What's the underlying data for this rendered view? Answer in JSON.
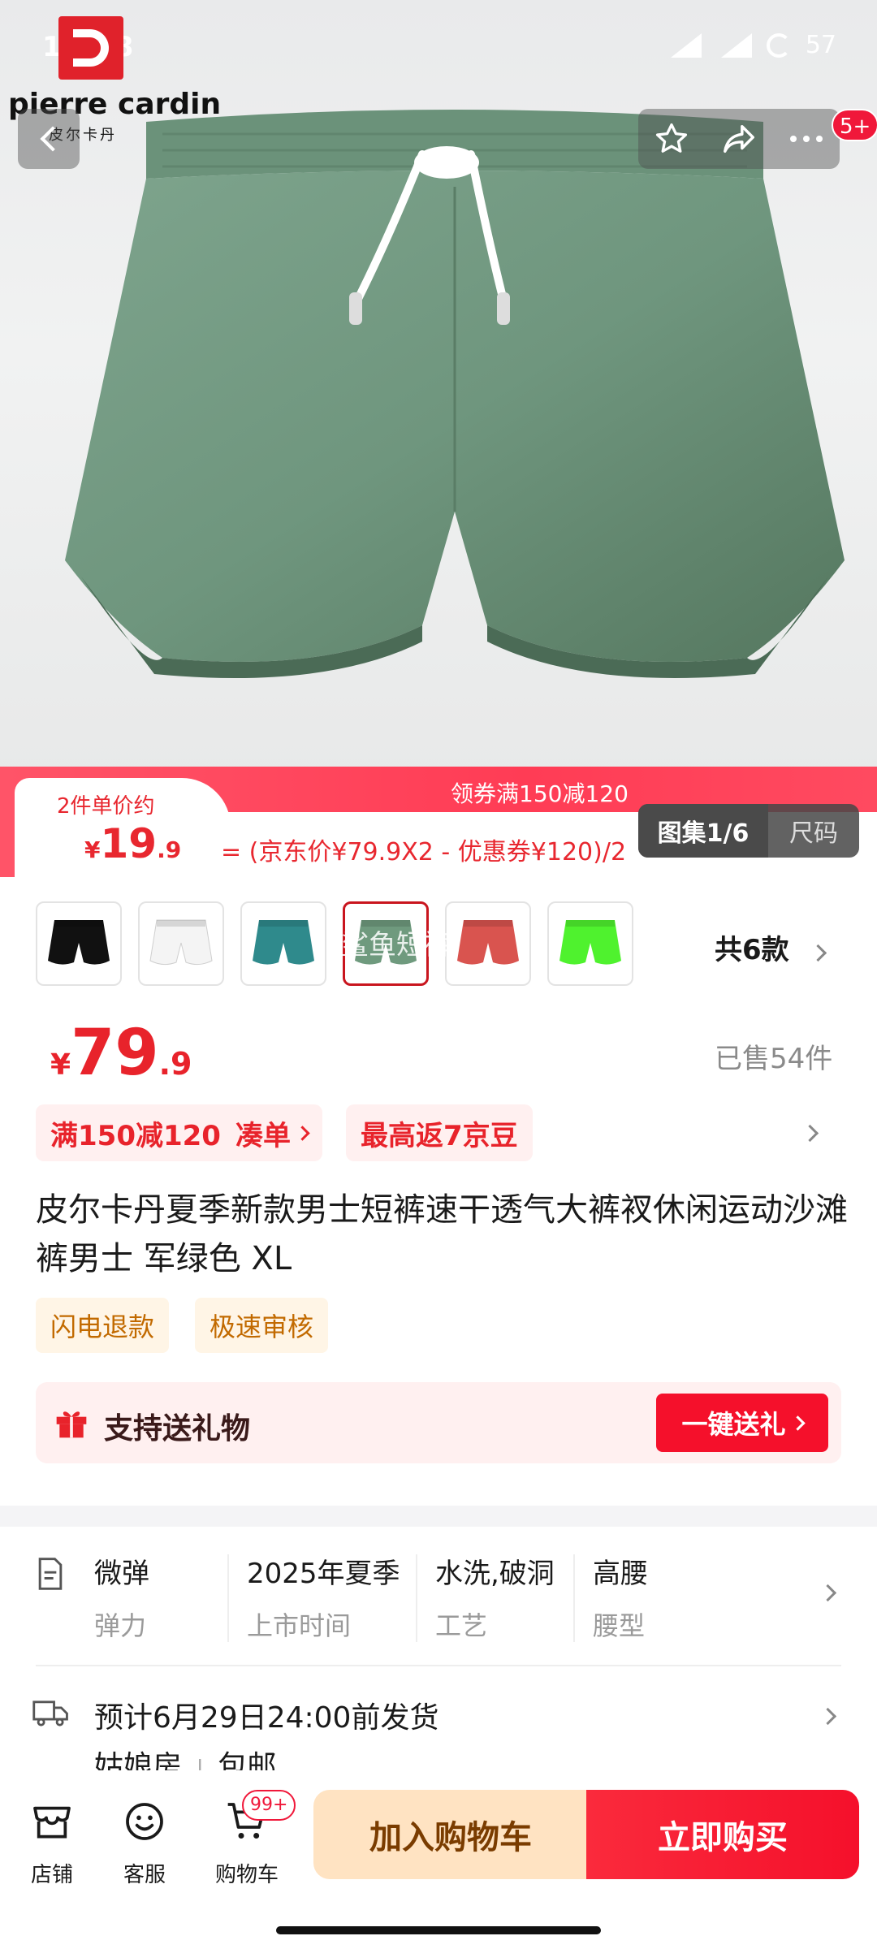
{
  "status_bar": {
    "time": "13:38",
    "battery": "57"
  },
  "brand": {
    "name": "pierre cardin",
    "name_cn": "皮尔卡丹"
  },
  "header": {
    "badge": "5+"
  },
  "promo": {
    "label": "2件单价约",
    "currency": "¥",
    "price_int": "19",
    "price_dec": ".9",
    "title": "领券满150减120",
    "formula": "= (京东价¥79.9X2 - 优惠券¥120)/2"
  },
  "gallery": {
    "images_label": "图集1/6",
    "size_label": "尺码"
  },
  "variants": {
    "colors": [
      "#111111",
      "#f4f4f4",
      "#2f8a8c",
      "#6f9a7e",
      "#d9544f",
      "#4ff22e"
    ],
    "selected_index": 3,
    "overlay_text": "鲨鱼短裤",
    "count_label": "共6款"
  },
  "price": {
    "currency": "¥",
    "int": "79",
    "dec": ".9",
    "sold": "已售54件"
  },
  "promotions": {
    "coupon": "满150减120",
    "coupon_action": "凑单",
    "beans": "最高返7京豆"
  },
  "product": {
    "title": "皮尔卡丹夏季新款男士短裤速干透气大裤衩休闲运动沙滩裤男士 军绿色 XL"
  },
  "service_tags": [
    "闪电退款",
    "极速审核"
  ],
  "gift": {
    "text": "支持送礼物",
    "button": "一键送礼"
  },
  "specs": [
    {
      "value": "微弹",
      "key": "弹力"
    },
    {
      "value": "2025年夏季",
      "key": "上市时间"
    },
    {
      "value": "水洗,破洞",
      "key": "工艺"
    },
    {
      "value": "高腰",
      "key": "腰型"
    }
  ],
  "shipping": {
    "estimate": "预计6月29日24:00前发货",
    "shop": "姑娘房",
    "sep": "|",
    "postage": "包邮"
  },
  "bottom_nav": {
    "shop": "店铺",
    "service": "客服",
    "cart": "购物车",
    "cart_badge": "99+"
  },
  "actions": {
    "add_to_cart": "加入购物车",
    "buy_now": "立即购买"
  }
}
